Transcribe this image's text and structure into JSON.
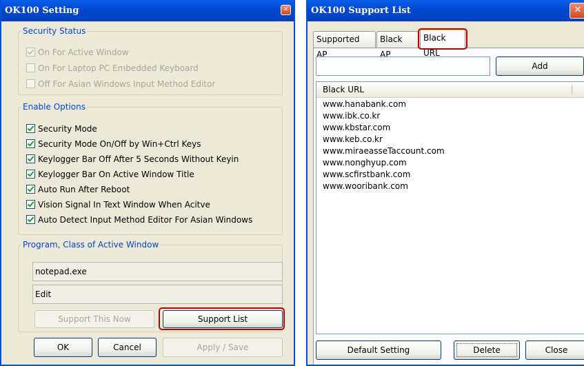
{
  "setting_window": {
    "title": "OK100 Setting",
    "security_status": {
      "legend": "Security Status",
      "items": [
        {
          "label": "On For Active Window",
          "checked": true
        },
        {
          "label": "On For Laptop PC Embedded Keyboard",
          "checked": false
        },
        {
          "label": "Off For Asian Windows Input Method Editor",
          "checked": false
        }
      ]
    },
    "enable_options": {
      "legend": "Enable Options",
      "items": [
        {
          "label": "Security Mode",
          "checked": true
        },
        {
          "label": "Security Mode On/Off by Win+Ctrl Keys",
          "checked": true
        },
        {
          "label": "Keylogger Bar Off After 5 Seconds Without Keyin",
          "checked": true
        },
        {
          "label": "Keylogger Bar On Active Window Title",
          "checked": true
        },
        {
          "label": "Auto Run After Reboot",
          "checked": true
        },
        {
          "label": "Vision Signal In Text Window When Acitve",
          "checked": true
        },
        {
          "label": "Auto Detect Input Method Editor For Asian Windows",
          "checked": true
        }
      ]
    },
    "program_class": {
      "legend": "Program, Class of Active Window",
      "program": "notepad.exe",
      "class": "Edit",
      "support_now_label": "Support This Now",
      "support_list_label": "Support List"
    },
    "ok_label": "OK",
    "cancel_label": "Cancel",
    "apply_label": "Apply / Save"
  },
  "support_window": {
    "title": "OK100 Support List",
    "tabs": [
      {
        "label": "Supported AP",
        "active": false
      },
      {
        "label": "Black AP",
        "active": false
      },
      {
        "label": "Black URL",
        "active": true
      }
    ],
    "url_input_value": "",
    "add_label": "Add",
    "list_header": "Black URL",
    "urls": [
      "www.hanabank.com",
      "www.ibk.co.kr",
      "www.kbstar.com",
      "www.keb.co.kr",
      "www.miraeasseTaccount.com",
      "www.nonghyup.com",
      "www.scfirstbank.com",
      "www.wooribank.com"
    ],
    "default_setting_label": "Default Setting",
    "delete_label": "Delete",
    "close_label": "Close"
  },
  "colors": {
    "titlebar": "#0048d0",
    "legend_text": "#0046d5",
    "highlight": "#c00000",
    "check": "#21a121"
  }
}
